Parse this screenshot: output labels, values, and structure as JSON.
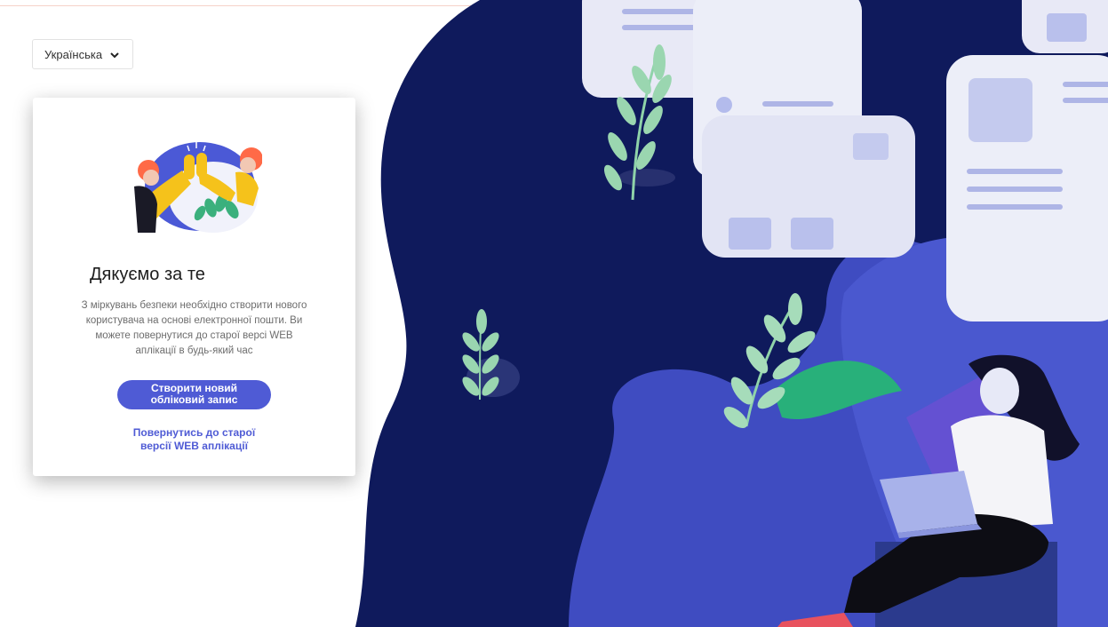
{
  "language_selector": {
    "selected": "Українська",
    "chevron_icon": "chevron-down-icon"
  },
  "card": {
    "illustration_icon": "high-five-illustration",
    "title": "Дякуємо за те",
    "description_lines": [
      "З міркувань безпеки необхідно створити нового",
      "користувача на основі електронної пошти. Ви",
      "можете повернутися до старої версі WEB",
      "аплікації в будь-який час"
    ],
    "create_button_lines": [
      "Створити новий",
      "обліковий запис"
    ],
    "back_link_lines": [
      "Повернутись до старої",
      "версії WEB аплікації"
    ]
  },
  "colors": {
    "accent": "#4f5bd5",
    "navy": "#0f1a5c",
    "blue": "#3f4cc1",
    "light_paper": "#e8e9f6",
    "leaf_green": "#8fd3a9"
  }
}
